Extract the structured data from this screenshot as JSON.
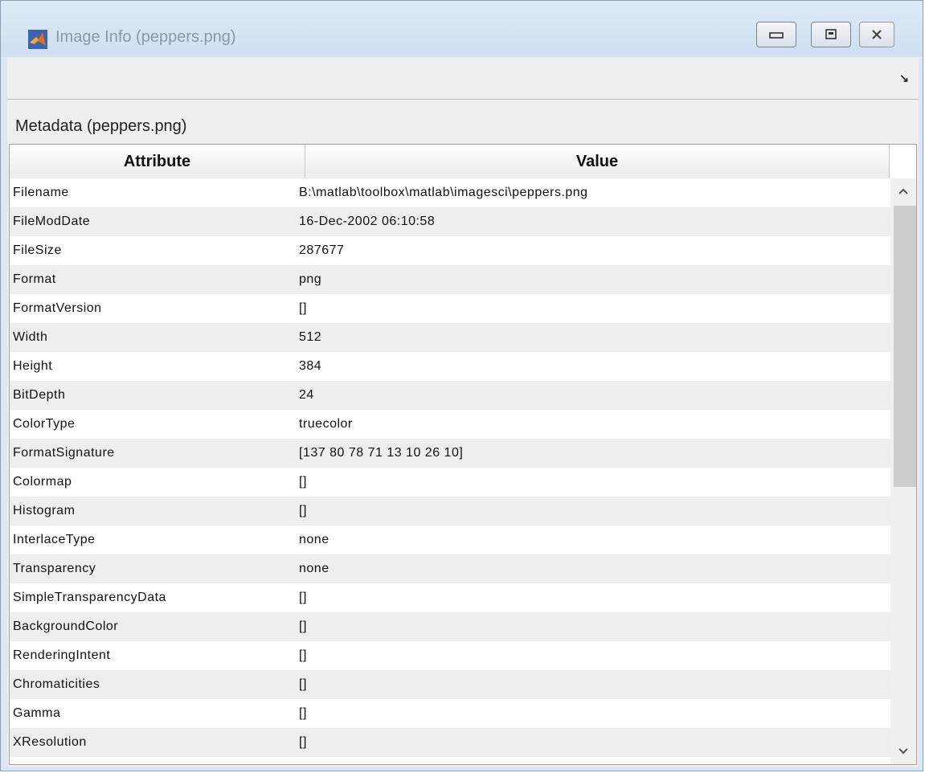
{
  "window": {
    "title": "Image Info (peppers.png)",
    "icon": "matlab-logo-icon"
  },
  "titlebar_buttons": [
    "minimize-icon",
    "maximize-icon",
    "close-icon"
  ],
  "toolbar": {
    "dock_icon": "undock-arrow-icon"
  },
  "panel": {
    "title": "Metadata (peppers.png)"
  },
  "table": {
    "columns": [
      "Attribute",
      "Value"
    ],
    "rows": [
      {
        "attribute": "Filename",
        "value": "B:\\matlab\\toolbox\\matlab\\imagesci\\peppers.png"
      },
      {
        "attribute": "FileModDate",
        "value": "16-Dec-2002 06:10:58"
      },
      {
        "attribute": "FileSize",
        "value": "287677"
      },
      {
        "attribute": "Format",
        "value": "png"
      },
      {
        "attribute": "FormatVersion",
        "value": "[]"
      },
      {
        "attribute": "Width",
        "value": "512"
      },
      {
        "attribute": "Height",
        "value": "384"
      },
      {
        "attribute": "BitDepth",
        "value": "24"
      },
      {
        "attribute": "ColorType",
        "value": "truecolor"
      },
      {
        "attribute": "FormatSignature",
        "value": "[137 80 78 71 13 10 26 10]"
      },
      {
        "attribute": "Colormap",
        "value": "[]"
      },
      {
        "attribute": "Histogram",
        "value": "[]"
      },
      {
        "attribute": "InterlaceType",
        "value": "none"
      },
      {
        "attribute": "Transparency",
        "value": "none"
      },
      {
        "attribute": "SimpleTransparencyData",
        "value": "[]"
      },
      {
        "attribute": "BackgroundColor",
        "value": "[]"
      },
      {
        "attribute": "RenderingIntent",
        "value": "[]"
      },
      {
        "attribute": "Chromaticities",
        "value": "[]"
      },
      {
        "attribute": "Gamma",
        "value": "[]"
      },
      {
        "attribute": "XResolution",
        "value": "[]"
      }
    ]
  },
  "scrollbar": {
    "up_icon": "chevron-up-icon",
    "down_icon": "chevron-down-icon"
  }
}
